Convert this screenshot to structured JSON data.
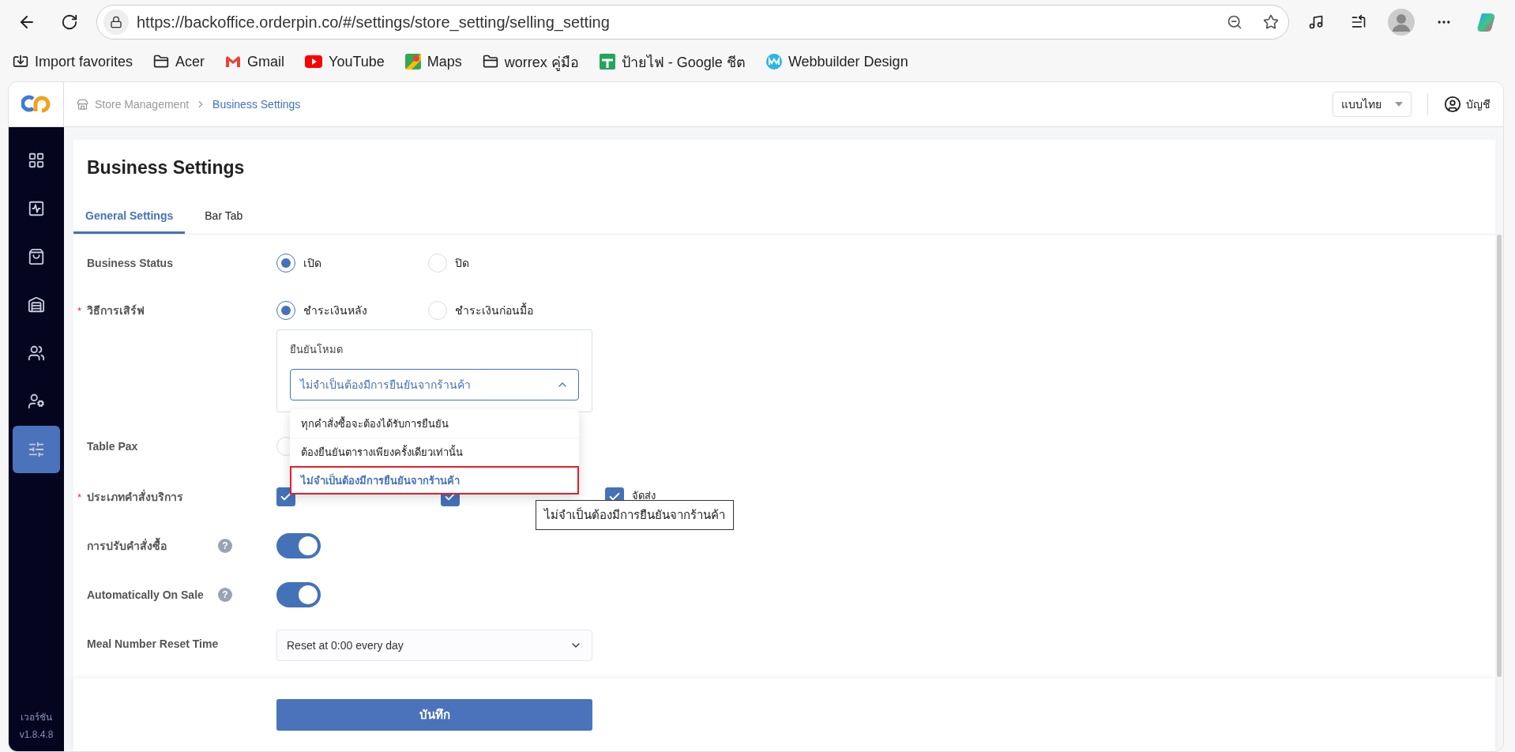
{
  "browser": {
    "url": "https://backoffice.orderpin.co/#/settings/store_setting/selling_setting",
    "bookmarks": [
      {
        "kind": "import",
        "label": "Import favorites"
      },
      {
        "kind": "folder",
        "label": "Acer"
      },
      {
        "kind": "gmail",
        "label": "Gmail"
      },
      {
        "kind": "youtube",
        "label": "YouTube"
      },
      {
        "kind": "maps",
        "label": "Maps"
      },
      {
        "kind": "folder",
        "label": "worrex คู่มือ"
      },
      {
        "kind": "sheets",
        "label": "ป้ายไฟ - Google ชีต"
      },
      {
        "kind": "webbuilder",
        "label": "Webbuilder Design"
      }
    ]
  },
  "header": {
    "breadcrumb": [
      {
        "label": "Store Management",
        "selected": false
      },
      {
        "label": "Business Settings",
        "selected": true
      }
    ],
    "language": "แบบไทย",
    "account": "บัญชี"
  },
  "sidebar": {
    "items": [
      {
        "kind": "dashboard",
        "selected": false
      },
      {
        "kind": "activity",
        "selected": false
      },
      {
        "kind": "bag",
        "selected": false
      },
      {
        "kind": "warehouse",
        "selected": false
      },
      {
        "kind": "users",
        "selected": false
      },
      {
        "kind": "user-settings",
        "selected": false
      },
      {
        "kind": "settings",
        "selected": true
      }
    ],
    "version_label": "เวอร์ชัน",
    "version": "v1.8.4.8"
  },
  "page": {
    "title": "Business Settings",
    "tabs": [
      {
        "label": "General Settings",
        "selected": true
      },
      {
        "label": "Bar Tab",
        "selected": false
      }
    ],
    "rows": [
      {
        "kind": "radio",
        "label": "Business Status",
        "options": [
          {
            "label": "เปิด",
            "selected": true
          },
          {
            "label": "ปิด",
            "selected": false
          }
        ]
      },
      {
        "kind": "radio",
        "label": "วิธีการเสิร์ฟ",
        "required_mark": "*",
        "options": [
          {
            "label": "ชำระเงินหลัง",
            "selected": true
          },
          {
            "label": "ชำระเงินก่อนมื้อ",
            "selected": false
          }
        ],
        "confirm": {
          "label": "ยืนยันโหมด",
          "value": "ไม่จำเป็นต้องมีการยืนยันจากร้านค้า",
          "expanded": true,
          "options": [
            {
              "label": "ทุกคำสั่งซื้อจะต้องได้รับการยืนยัน",
              "selected": false
            },
            {
              "label": "ต้องยืนยันตารางเพียงครั้งเดียวเท่านั้น",
              "selected": false
            },
            {
              "label": "ไม่จำเป็นต้องมีการยืนยันจากร้านค้า",
              "selected": true
            }
          ]
        }
      },
      {
        "kind": "covered",
        "label": "Table Pax",
        "selected": false
      },
      {
        "kind": "checkboxes",
        "label": "ประเภทคำสั่งบริการ",
        "required_mark": "*",
        "options": [
          {
            "checked": true
          },
          {
            "checked": true
          },
          {
            "label": "จัดส่ง",
            "checked": true
          }
        ],
        "tooltip": "ไม่จำเป็นต้องมีการยืนยันจากร้านค้า"
      },
      {
        "kind": "toggle",
        "label": "การปรับคำสั่งซื้อ",
        "help": "?",
        "on": true
      },
      {
        "kind": "toggle",
        "label": "Automatically On Sale",
        "help": "?",
        "on": true
      },
      {
        "kind": "select",
        "label": "Meal Number Reset Time",
        "value": "Reset at 0:00 every day"
      }
    ],
    "save": "บันทึก"
  }
}
